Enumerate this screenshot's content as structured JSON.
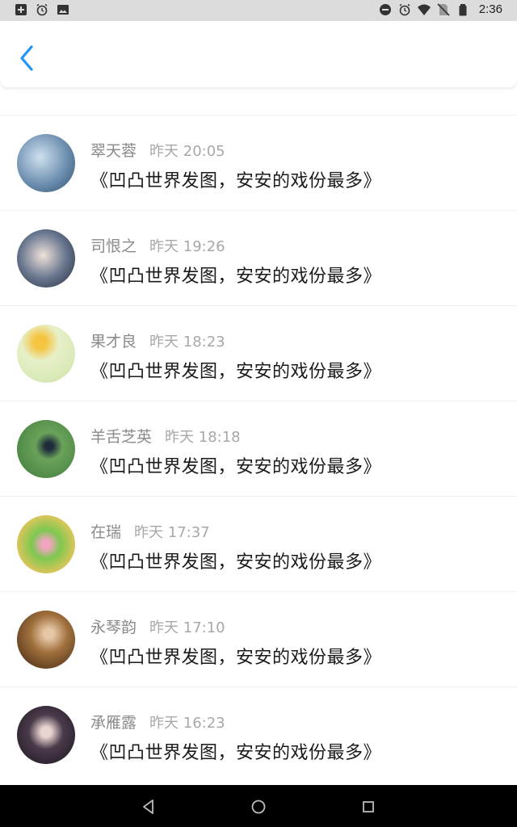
{
  "status_bar": {
    "time": "2:36",
    "left_icons": [
      "plus-box-icon",
      "alarm-icon",
      "image-icon"
    ],
    "right_icons": [
      "do-not-disturb-icon",
      "alarm-icon",
      "wifi-icon",
      "no-sim-icon",
      "battery-icon"
    ]
  },
  "header": {
    "back_icon": "chevron-left-icon",
    "accent_color": "#2196f3"
  },
  "messages": [
    {
      "name": "翠天蓉",
      "time": "昨天 20:05",
      "text": "《凹凸世界发图，安安的戏份最多》"
    },
    {
      "name": "司恨之",
      "time": "昨天 19:26",
      "text": "《凹凸世界发图，安安的戏份最多》"
    },
    {
      "name": "果才良",
      "time": "昨天 18:23",
      "text": "《凹凸世界发图，安安的戏份最多》"
    },
    {
      "name": "羊舌芝英",
      "time": "昨天 18:18",
      "text": "《凹凸世界发图，安安的戏份最多》"
    },
    {
      "name": "在瑞",
      "time": "昨天 17:37",
      "text": "《凹凸世界发图，安安的戏份最多》"
    },
    {
      "name": "永琴韵",
      "time": "昨天 17:10",
      "text": "《凹凸世界发图，安安的戏份最多》"
    },
    {
      "name": "承雁露",
      "time": "昨天 16:23",
      "text": "《凹凸世界发图，安安的戏份最多》"
    }
  ],
  "nav_bar": {
    "icons": [
      "back-triangle-icon",
      "home-circle-icon",
      "recents-square-icon"
    ]
  }
}
